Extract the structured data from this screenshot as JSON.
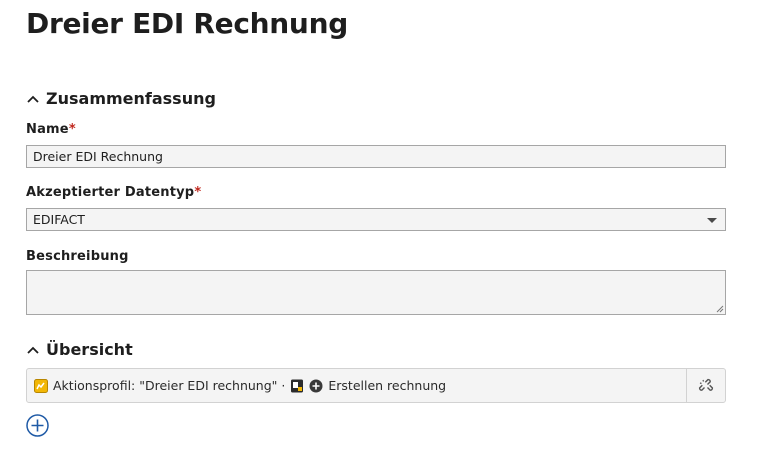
{
  "page": {
    "title": "Dreier EDI Rechnung"
  },
  "summary": {
    "header": "Zusammenfassung",
    "name_label": "Name",
    "name_value": "Dreier EDI Rechnung",
    "datatype_label": "Akzeptierter Datentyp",
    "datatype_value": "EDIFACT",
    "description_label": "Beschreibung",
    "description_value": "",
    "required_marker": "*"
  },
  "overview": {
    "header": "Übersicht",
    "item_text": "Aktionsprofil: \"Dreier EDI rechnung\" ·",
    "action_text": "Erstellen rechnung"
  },
  "colors": {
    "accent": "#1f5aa6",
    "required": "#c0281e",
    "profile_icon": "#f2b705"
  }
}
